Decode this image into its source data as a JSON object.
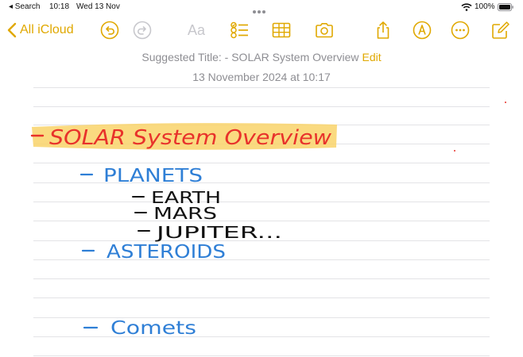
{
  "status_bar": {
    "back_app": "◂ Search",
    "time": "10:18",
    "date": "Wed 13 Nov",
    "battery": "100%"
  },
  "toolbar": {
    "back_label": "All iCloud",
    "format_label": "Aa",
    "accent": "#e0a800",
    "icons": [
      "chevron-left-icon",
      "undo-icon",
      "redo-icon",
      "checklist-icon",
      "table-icon",
      "camera-icon",
      "share-icon",
      "markup-icon",
      "more-icon",
      "compose-icon"
    ]
  },
  "note": {
    "suggested_title": "Suggested Title: - SOLAR System Overview",
    "edit_label": "Edit",
    "date": "13 November 2024 at 10:17"
  },
  "handwriting": {
    "title": "SOLAR System Overview",
    "title_color": "#e8322b",
    "highlight_color": "#f9d36a",
    "blue": "#2f7fd6",
    "black": "#111111",
    "items": [
      {
        "text": "PLANETS",
        "color": "blue"
      },
      {
        "text": "EARTH",
        "color": "black"
      },
      {
        "text": "MARS",
        "color": "black"
      },
      {
        "text": "JUPITER...",
        "color": "black"
      },
      {
        "text": "ASTEROIDS",
        "color": "blue"
      },
      {
        "text": "Comets",
        "color": "blue"
      }
    ]
  }
}
